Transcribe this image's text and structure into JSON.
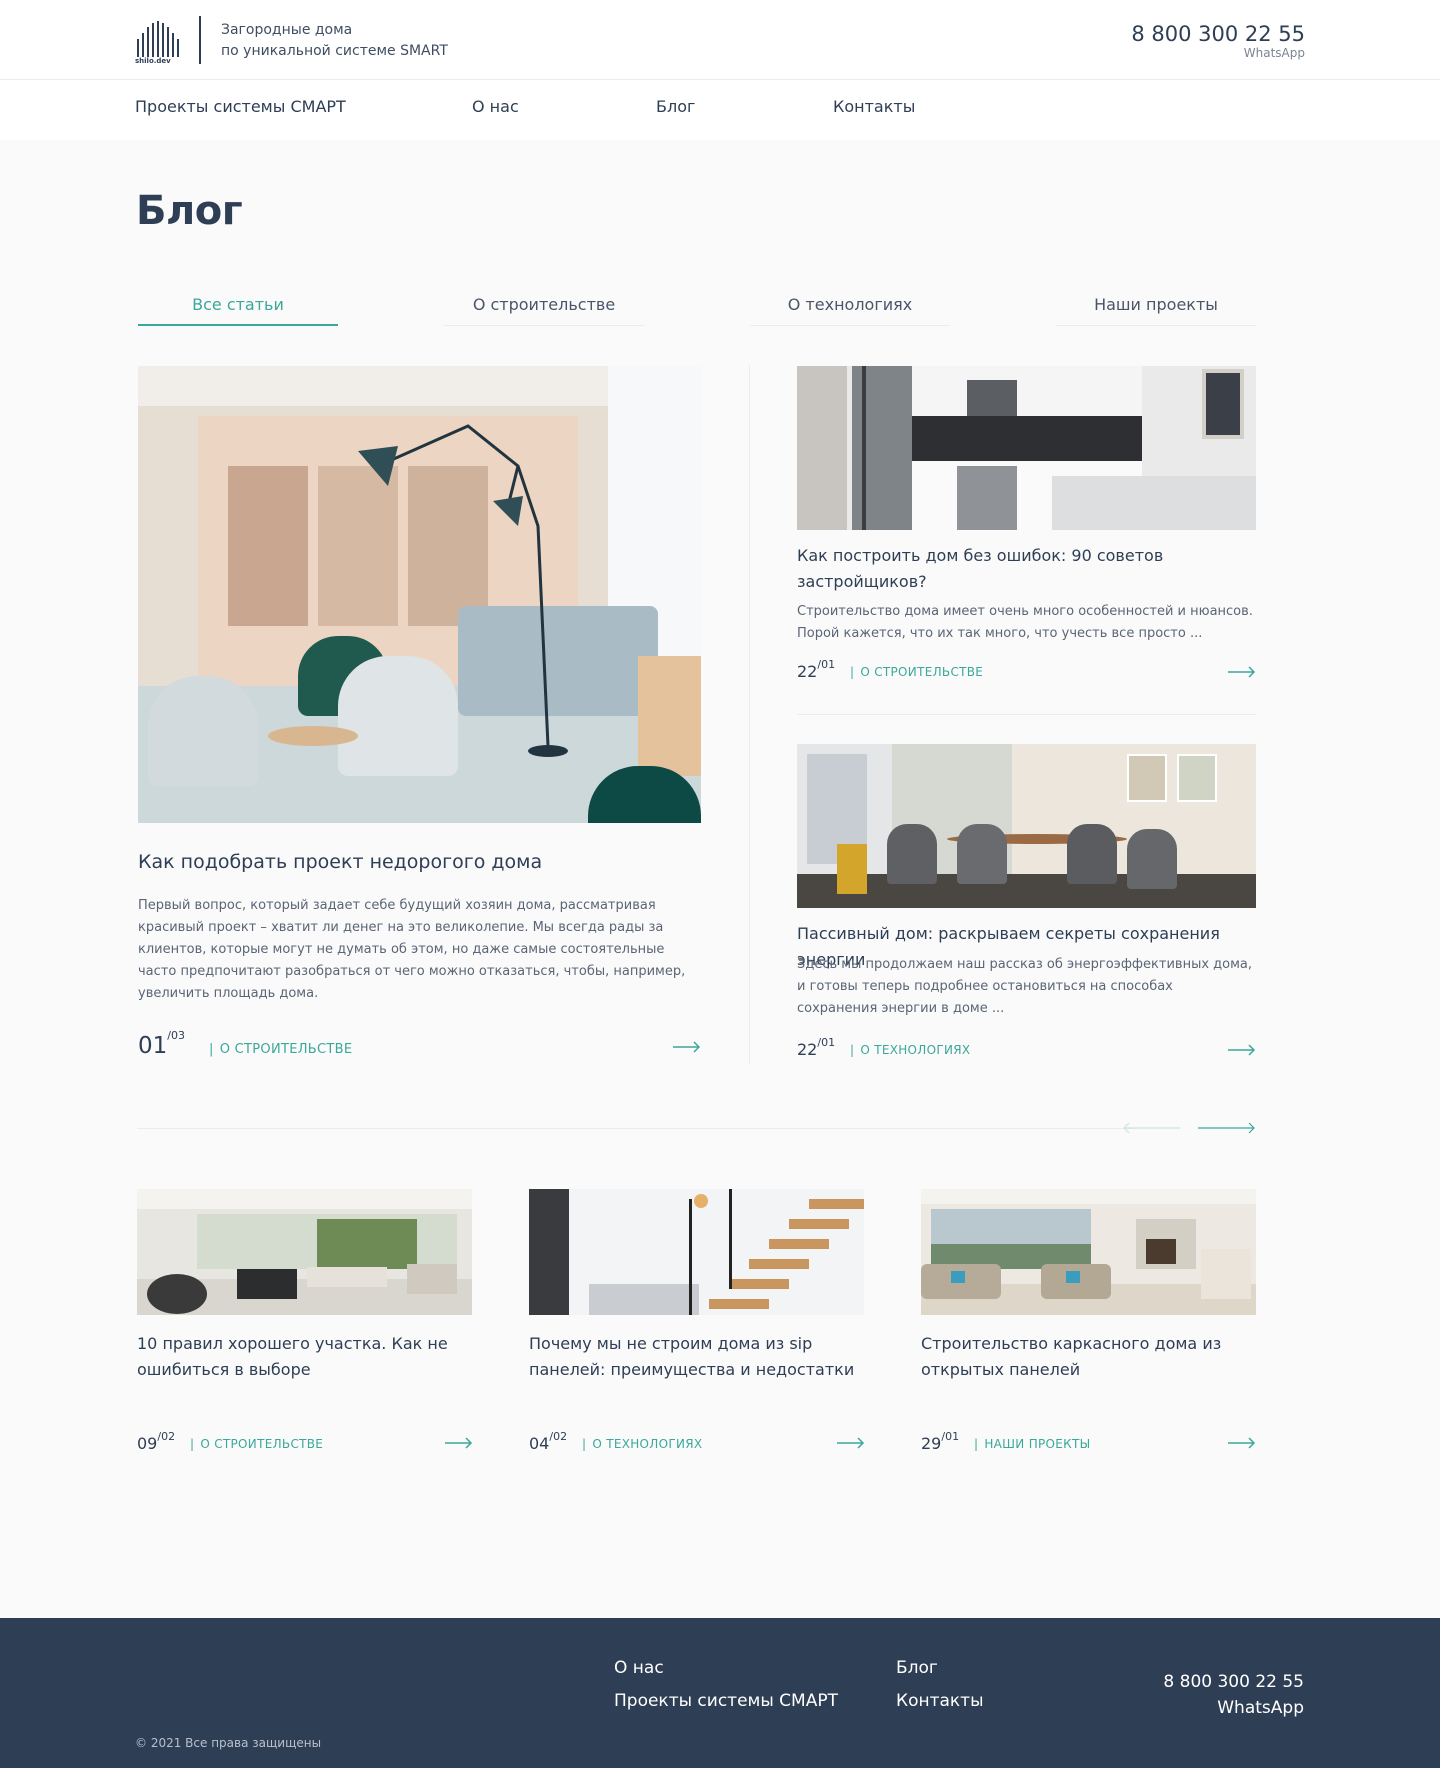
{
  "header": {
    "logo_text": "shilo.dev",
    "tagline_line1": "Загородные дома",
    "tagline_line2": "по уникальной системе SMART",
    "phone": "8 800 300 22 55",
    "whatsapp": "WhatsApp"
  },
  "nav": {
    "items": [
      "Проекты системы СМАРТ",
      "О нас",
      "Блог",
      "Контакты"
    ]
  },
  "page": {
    "title": "Блог"
  },
  "tabs": [
    {
      "label": "Все статьи",
      "active": true
    },
    {
      "label": "О строительстве",
      "active": false
    },
    {
      "label": "О технологиях",
      "active": false
    },
    {
      "label": "Наши проекты",
      "active": false
    }
  ],
  "featured": {
    "title": "Как подобрать проект недорогого дома",
    "excerpt": "Первый вопрос, который задает себе будущий хозяин дома, рассматривая красивый проект – хватит ли денег на это великолепие. Мы всегда рады за клиентов, которые могут не думать об этом, но даже самые состоятельные часто предпочитают разобраться от чего можно отказаться, чтобы, например, увеличить площадь дома.",
    "day": "01",
    "month": "03",
    "category": "О СТРОИТЕЛЬСТВЕ"
  },
  "side_articles": [
    {
      "title": "Как построить дом без ошибок: 90 советов застройщиков?",
      "excerpt": "Строительство дома имеет очень много особенностей и нюансов. Порой кажется, что их так много, что учесть все просто ...",
      "day": "22",
      "month": "01",
      "category": "О СТРОИТЕЛЬСТВЕ"
    },
    {
      "title": "Пассивный дом: раскрываем секреты сохранения энергии",
      "excerpt": "Здесь мы продолжаем наш рассказ об энергоэффективных дома, и готовы теперь подробнее остановиться на способах сохранения энергии в доме ...",
      "day": "22",
      "month": "01",
      "category": "О ТЕХНОЛОГИЯХ"
    }
  ],
  "grid_articles": [
    {
      "title": "10 правил хорошего участка. Как не ошибиться в выборе",
      "day": "09",
      "month": "02",
      "category": "О СТРОИТЕЛЬСТВЕ"
    },
    {
      "title": "Почему мы не строим дома из sip панелей: преимущества и недостатки",
      "day": "04",
      "month": "02",
      "category": "О ТЕХНОЛОГИЯХ"
    },
    {
      "title": "Строительство каркасного дома из открытых панелей",
      "day": "29",
      "month": "01",
      "category": "НАШИ ПРОЕКТЫ"
    }
  ],
  "footer": {
    "links": [
      "О нас",
      "Проекты системы СМАРТ",
      "Блог",
      "Контакты"
    ],
    "phone": "8 800 300 22 55",
    "whatsapp": "WhatsApp",
    "copyright": "© 2021 Все права защищены"
  },
  "colors": {
    "accent": "#3aa89a",
    "dark": "#2e3e55",
    "background": "#fafafa"
  }
}
